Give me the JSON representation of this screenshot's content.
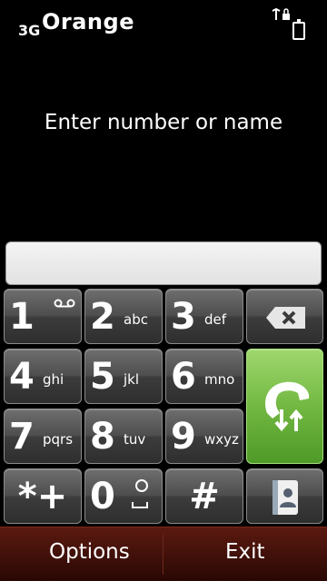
{
  "status": {
    "network": "3G",
    "operator": "Orange"
  },
  "prompt": "Enter number or name",
  "input": {
    "value": ""
  },
  "keys": [
    {
      "digit": "1",
      "letters": ""
    },
    {
      "digit": "2",
      "letters": "abc"
    },
    {
      "digit": "3",
      "letters": "def"
    },
    {
      "digit": "4",
      "letters": "ghi"
    },
    {
      "digit": "5",
      "letters": "jkl"
    },
    {
      "digit": "6",
      "letters": "mno"
    },
    {
      "digit": "7",
      "letters": "pqrs"
    },
    {
      "digit": "8",
      "letters": "tuv"
    },
    {
      "digit": "9",
      "letters": "wxyz"
    },
    {
      "digit": "*+",
      "letters": ""
    },
    {
      "digit": "0",
      "letters": ""
    },
    {
      "digit": "#",
      "letters": ""
    }
  ],
  "softkeys": {
    "left": "Options",
    "right": "Exit"
  },
  "icons": {
    "voicemail": "voicemail-icon",
    "space": "space-icon",
    "delete": "backspace-icon",
    "call": "call-icon",
    "contacts": "contacts-icon",
    "signal": "signal-icon",
    "battery": "battery-icon"
  },
  "colors": {
    "call_green": "#72b842",
    "softbar_red": "#5a1a10",
    "key_gray": "#4e4e4e"
  }
}
